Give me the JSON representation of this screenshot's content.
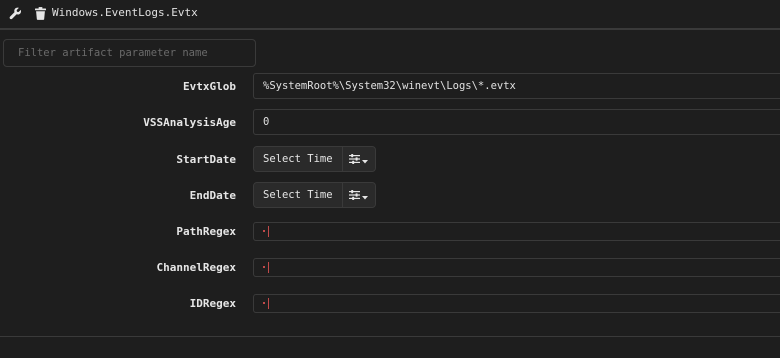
{
  "header": {
    "title": "Windows.EventLogs.Evtx",
    "icons": [
      "wrench-icon",
      "trash-icon"
    ]
  },
  "filter": {
    "placeholder": "Filter artifact parameter name",
    "value": ""
  },
  "params": [
    {
      "label": "EvtxGlob",
      "value": "%SystemRoot%\\System32\\winevt\\Logs\\*.evtx"
    },
    {
      "label": "VSSAnalysisAge",
      "value": "0"
    },
    {
      "label": "StartDate",
      "button": "Select Time"
    },
    {
      "label": "EndDate",
      "button": "Select Time"
    },
    {
      "label": "PathRegex",
      "value": "."
    },
    {
      "label": "ChannelRegex",
      "value": "."
    },
    {
      "label": "IDRegex",
      "value": "."
    }
  ],
  "colors": {
    "background": "#1e1e1e",
    "border": "#3a3a3a",
    "button": "#2a2a2a",
    "cursor": "#c04a4a"
  }
}
